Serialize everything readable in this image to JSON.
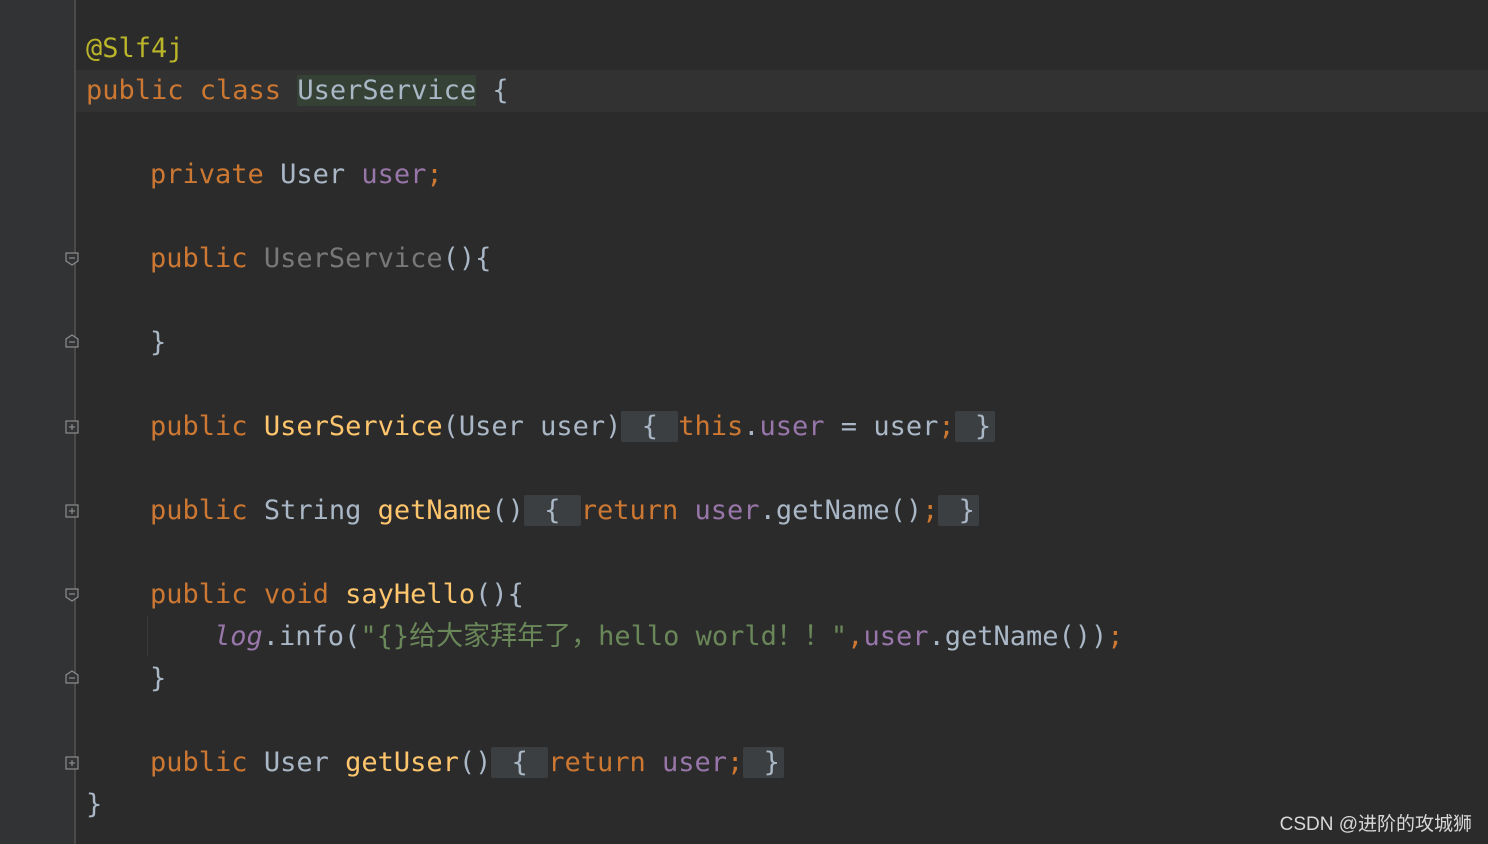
{
  "code": {
    "annotation": "@Slf4j",
    "class_keywords": "public class ",
    "class_name": "UserService",
    "class_open": " {",
    "field_line": {
      "modifier": "private",
      "type": "User",
      "name": "user",
      "semi": ";"
    },
    "ctor1": {
      "modifier": "public",
      "name": "UserService",
      "rest": "(){"
    },
    "close_brace": "}",
    "ctor2": {
      "modifier": "public",
      "name": "UserService",
      "params": "(User user)",
      "fold_open": " { ",
      "this_kw": "this",
      "dot": ".",
      "field": "user",
      "assign": " = user",
      "semi": ";",
      "fold_close": " }"
    },
    "getName": {
      "modifier": "public",
      "type": "String",
      "name": "getName",
      "parens": "()",
      "fold_open": " { ",
      "ret_kw": "return",
      "field": "user",
      "call": ".getName()",
      "semi": ";",
      "fold_close": " }"
    },
    "sayHello": {
      "modifier": "public",
      "type": "void",
      "name": "sayHello",
      "rest": "(){"
    },
    "log_line": {
      "logger": "log",
      "call": ".info(",
      "string": "\"{}给大家拜年了，hello world！！\"",
      "comma": ",",
      "field": "user",
      "call2": ".getName())",
      "semi": ";"
    },
    "getUser": {
      "modifier": "public",
      "type": "User",
      "name": "getUser",
      "parens": "()",
      "fold_open": " { ",
      "ret_kw": "return",
      "field": "user",
      "semi": ";",
      "fold_close": " }"
    },
    "class_close": "}"
  },
  "watermark": "CSDN @进阶的攻城狮",
  "colors": {
    "background": "#2b2b2b",
    "keyword": "#cc7832",
    "annotation": "#bbb529",
    "field": "#9876aa",
    "method": "#ffc66d",
    "string": "#6a8759",
    "text": "#a9b7c6"
  }
}
